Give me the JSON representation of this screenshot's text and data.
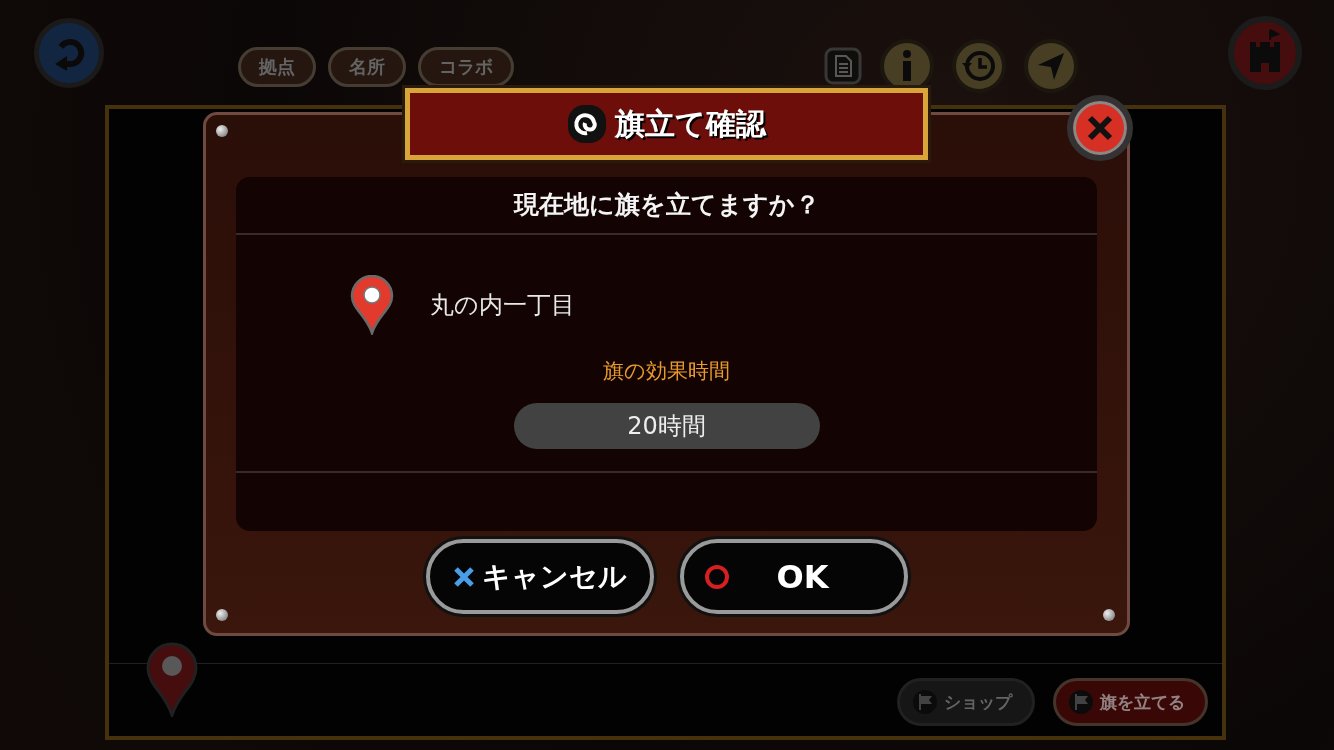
{
  "top_bar": {
    "tabs": [
      {
        "label": "拠点",
        "selected": false
      },
      {
        "label": "名所",
        "selected": false
      },
      {
        "label": "コラボ",
        "selected": false
      }
    ]
  },
  "map_panel": {
    "buttons": [
      {
        "label": "ショップ",
        "kind": "shop"
      },
      {
        "label": "旗を立てる",
        "kind": "flag"
      }
    ]
  },
  "dialog": {
    "title": "旗立て確認",
    "question": "現在地に旗を立てますか？",
    "location": "丸の内一丁目",
    "duration_label": "旗の効果時間",
    "duration": "20時間",
    "buttons": [
      {
        "label": "キャンセル",
        "kind": "cancel"
      },
      {
        "label": "OK",
        "kind": "ok"
      }
    ]
  }
}
